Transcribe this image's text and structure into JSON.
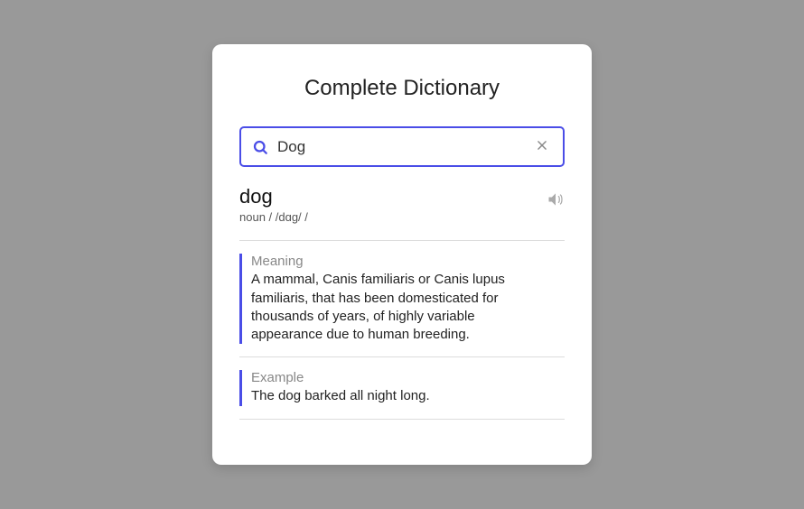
{
  "title": "Complete Dictionary",
  "search": {
    "value": "Dog"
  },
  "entry": {
    "word": "dog",
    "pos_line": "noun / /dɑg/ /",
    "meaning_label": "Meaning",
    "meaning_text": "A mammal, Canis familiaris or Canis lupus familiaris, that has been domesticated for thousands of years, of highly variable appearance due to human breeding.",
    "example_label": "Example",
    "example_text": "The dog barked all night long."
  }
}
